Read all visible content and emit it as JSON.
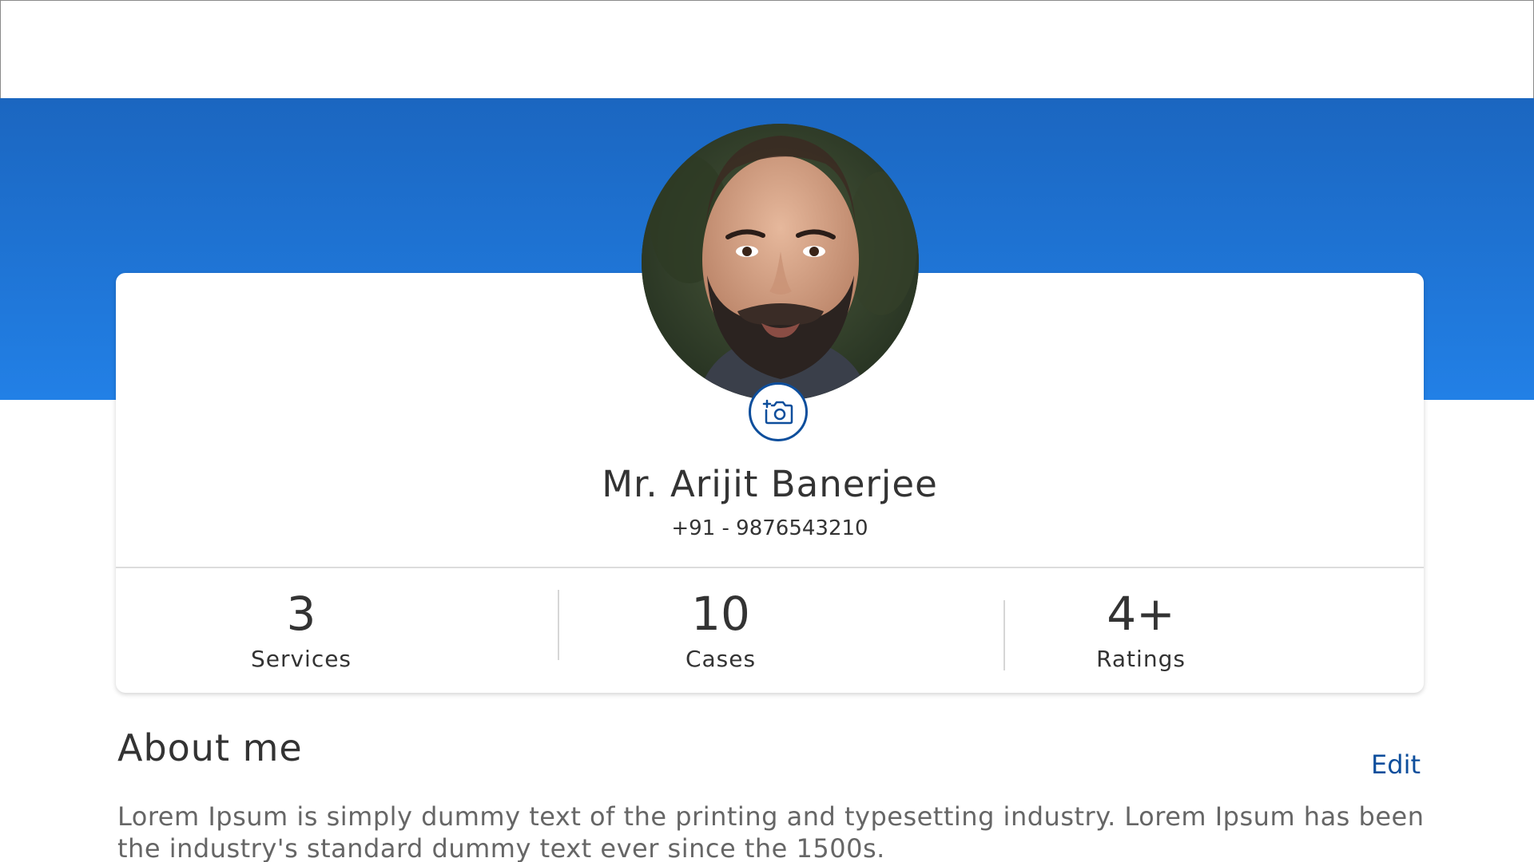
{
  "profile": {
    "name": "Mr. Arijit Banerjee",
    "phone": "+91 - 9876543210",
    "avatar_icon": "avatar-photo",
    "camera_icon": "camera-add-icon"
  },
  "stats": [
    {
      "value": "3",
      "label": "Services"
    },
    {
      "value": "10",
      "label": "Cases"
    },
    {
      "value": "4+",
      "label": "Ratings"
    }
  ],
  "about": {
    "title": "About me",
    "edit_label": "Edit",
    "text": "Lorem Ipsum is simply dummy text of the printing and typesetting industry. Lorem Ipsum has been the industry's standard dummy text ever since the 1500s."
  },
  "colors": {
    "banner_top": "#1b66c0",
    "banner_bottom": "#2280e6",
    "accent": "#0d4e9c",
    "text": "#333333"
  }
}
